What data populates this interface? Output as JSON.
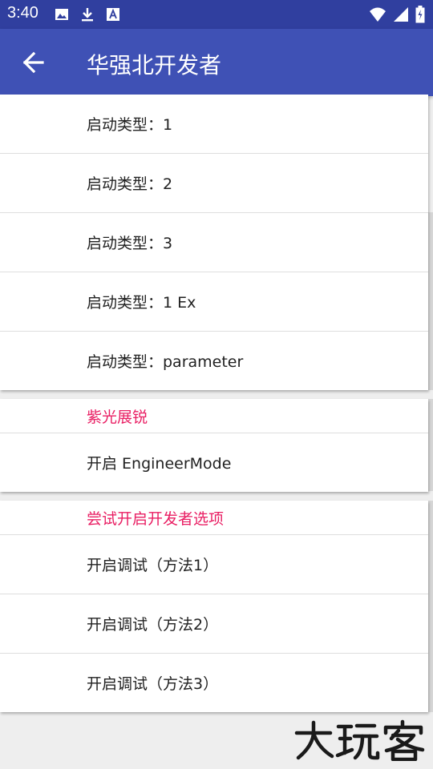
{
  "status_bar": {
    "time": "3:40",
    "left_icons": [
      "image-icon",
      "download-icon",
      "font-a-icon"
    ],
    "right_icons": [
      "wifi-icon",
      "signal-icon",
      "battery-charging-icon"
    ]
  },
  "app_bar": {
    "title": "华强北开发者",
    "back_icon": "arrow-back-icon",
    "color": "#3f51b5",
    "status_color": "#303f9f"
  },
  "launch_types": {
    "items": [
      {
        "label": "启动类型：1"
      },
      {
        "label": "启动类型：2"
      },
      {
        "label": "启动类型：3"
      },
      {
        "label": "启动类型：1 Ex"
      },
      {
        "label": "启动类型：parameter"
      }
    ]
  },
  "ziguang": {
    "header": "紫光展锐",
    "items": [
      {
        "label": "开启 EngineerMode"
      }
    ]
  },
  "developer_options": {
    "header": "尝试开启开发者选项",
    "items": [
      {
        "label": "开启调试（方法1）"
      },
      {
        "label": "开启调试（方法2）"
      },
      {
        "label": "开启调试（方法3）"
      }
    ]
  },
  "accent_color": "#e91e63",
  "watermark": "大玩客"
}
